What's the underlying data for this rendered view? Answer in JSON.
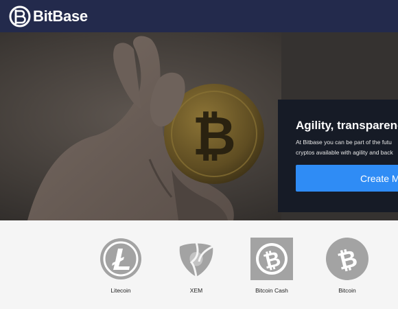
{
  "brand": {
    "name": "BitBase",
    "logo_icon": "bitbase-logo-icon"
  },
  "hero": {
    "image": "hand-holding-bitcoin-photo",
    "title": "Agility, transparenc",
    "description_lines": [
      "At Bitbase you can be part of the futu",
      "cryptos available with agility and back"
    ],
    "cta_label": "Create M"
  },
  "coins": [
    {
      "label": "Litecoin",
      "icon": "litecoin-icon"
    },
    {
      "label": "XEM",
      "icon": "xem-icon"
    },
    {
      "label": "Bitcoin Cash",
      "icon": "bitcoin-cash-icon"
    },
    {
      "label": "Bitcoin",
      "icon": "bitcoin-icon"
    }
  ],
  "colors": {
    "header_bg": "#232a4c",
    "cta_button": "#2f8cf5",
    "panel_bg": "#161b26",
    "coin_icon": "#a3a3a3"
  }
}
